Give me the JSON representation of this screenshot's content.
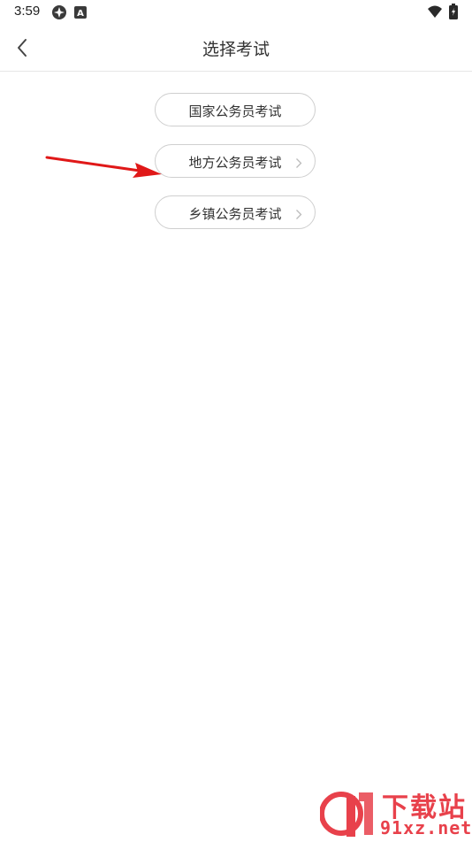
{
  "status_bar": {
    "time": "3:59",
    "icons": [
      "compass-icon",
      "a-badge-icon",
      "wifi-icon",
      "battery-icon"
    ]
  },
  "header": {
    "title": "选择考试",
    "back_icon": "chevron-left-icon"
  },
  "options": [
    {
      "label": "国家公务员考试",
      "has_chevron": false
    },
    {
      "label": "地方公务员考试",
      "has_chevron": true
    },
    {
      "label": "乡镇公务员考试",
      "has_chevron": true
    }
  ],
  "annotation": {
    "color": "#e01818"
  },
  "watermark": {
    "title": "下载站",
    "domain": "91xz.net",
    "color": "#e8414b"
  }
}
